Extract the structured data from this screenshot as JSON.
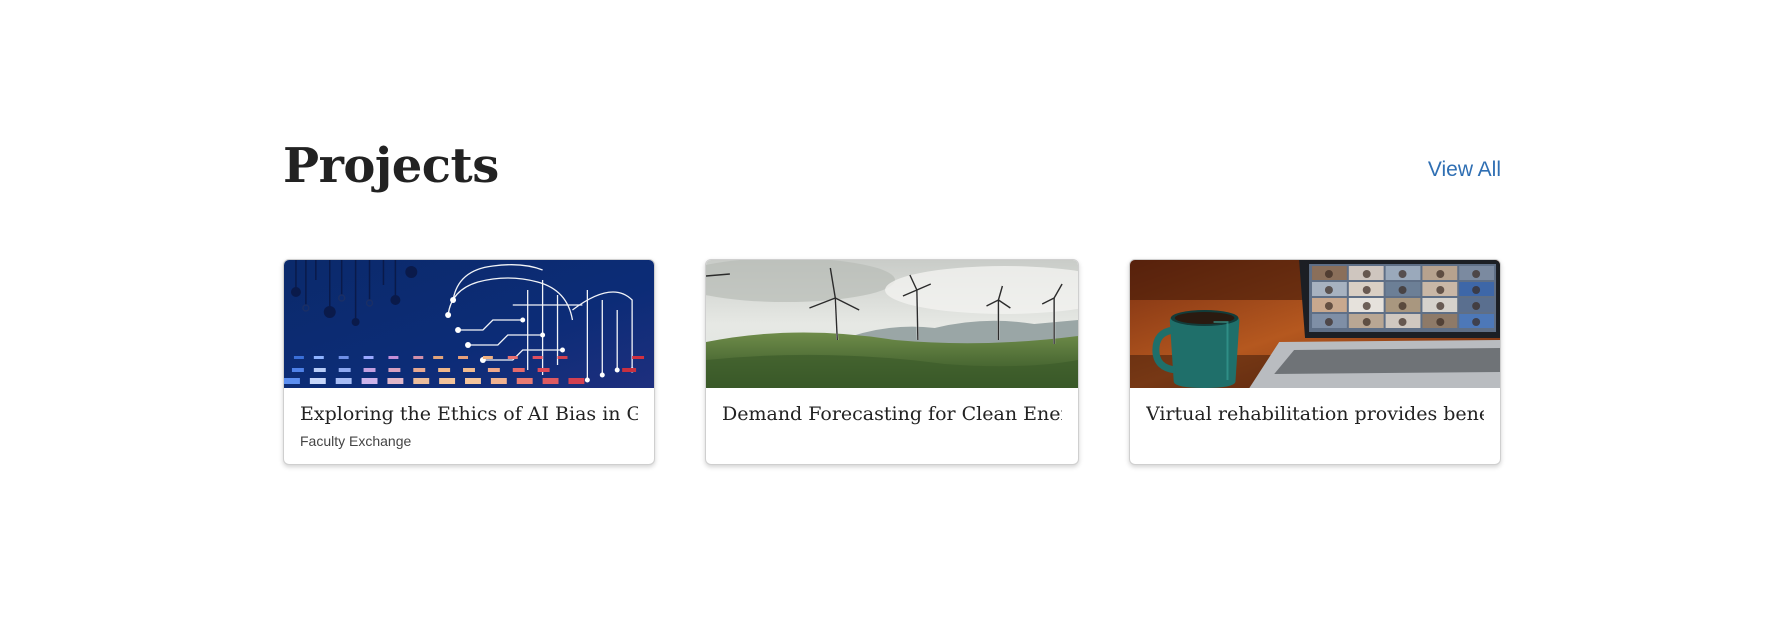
{
  "section": {
    "title": "Projects",
    "view_all_label": "View All"
  },
  "cards": [
    {
      "title": "Exploring the Ethics of AI Bias in Gl...",
      "subtitle": "Faculty Exchange",
      "image": "ai-circuit-brain-image"
    },
    {
      "title": "Demand Forecasting for Clean Energ...",
      "subtitle": "",
      "image": "wind-turbines-landscape-image"
    },
    {
      "title": "Virtual rehabilitation provides bene...",
      "subtitle": "",
      "image": "video-call-laptop-mug-image"
    }
  ],
  "colors": {
    "link": "#2f6fb3",
    "heading": "#222222",
    "card_border": "#cfcfcf"
  }
}
